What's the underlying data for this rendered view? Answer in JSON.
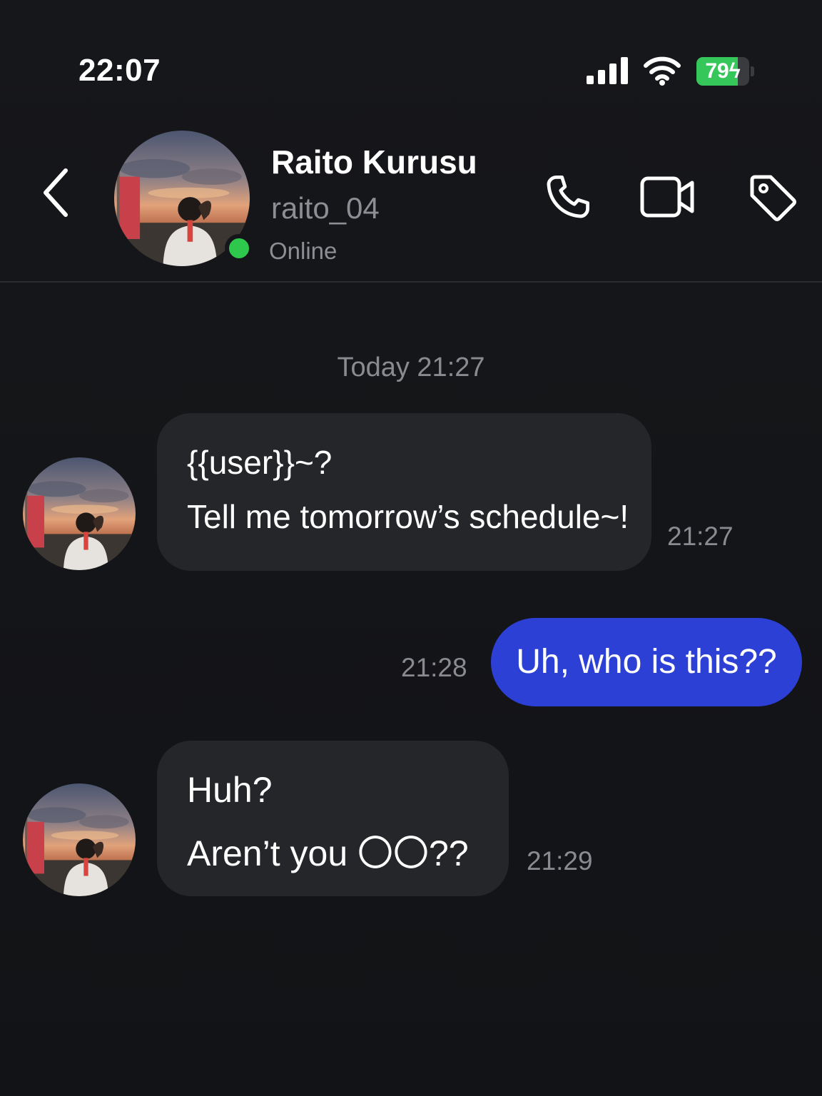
{
  "status_bar": {
    "time": "22:07",
    "battery_text": "79",
    "battery_level_percent": 79,
    "battery_charging": true,
    "battery_color": "#35c759",
    "signal_icon": "signal-bars-icon",
    "wifi_icon": "wifi-icon"
  },
  "header": {
    "back_icon": "chevron-left-icon",
    "name": "Raito Kurusu",
    "handle": "raito_04",
    "status": "Online",
    "status_color": "#2ec84d",
    "actions": [
      {
        "icon": "phone-icon"
      },
      {
        "icon": "video-camera-icon"
      },
      {
        "icon": "tag-icon"
      }
    ]
  },
  "conversation": {
    "date_label": "Today 21:27",
    "messages": [
      {
        "from": "contact",
        "lines": [
          "{{user}}~?",
          "Tell me tomorrow’s schedule~!"
        ],
        "time": "21:27"
      },
      {
        "from": "me",
        "lines": [
          "Uh, who is this??"
        ],
        "time": "21:28"
      },
      {
        "from": "contact",
        "lines": [
          "Huh?",
          "Aren’t you 〇〇??"
        ],
        "time": "21:29"
      }
    ]
  },
  "colors": {
    "background": "#151619",
    "incoming_bubble": "#25262a",
    "outgoing_bubble": "#2d40d6",
    "secondary_text": "#8a8b90"
  }
}
